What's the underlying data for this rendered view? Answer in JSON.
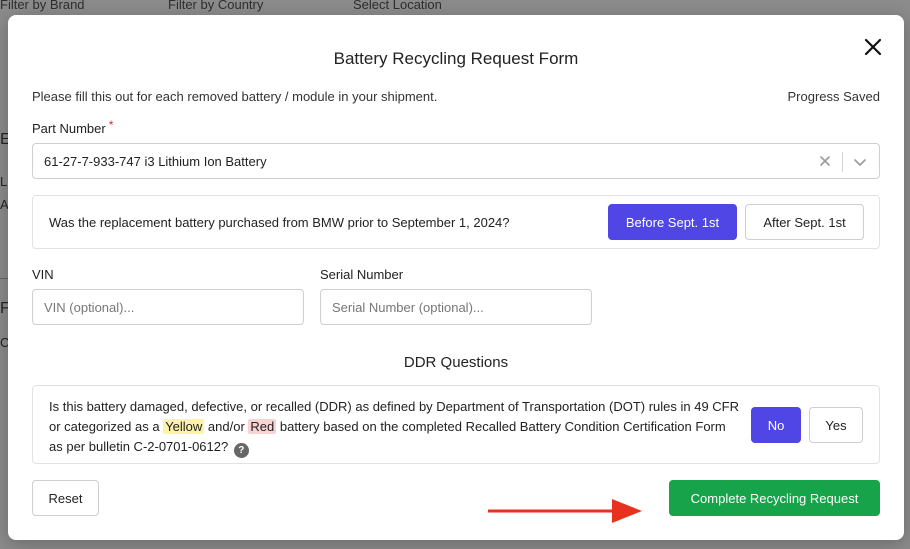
{
  "background": {
    "filters": [
      "Filter by Brand",
      "Filter by Country",
      "Select Location"
    ],
    "letters": [
      "E",
      "L",
      "A",
      "F",
      "C"
    ]
  },
  "modal": {
    "title": "Battery Recycling Request Form",
    "intro": "Please fill this out for each removed battery / module in your shipment.",
    "progress_status": "Progress Saved",
    "part_number": {
      "label": "Part Number",
      "required_mark": "*",
      "value": "61-27-7-933-747 i3 Lithium Ion Battery"
    },
    "purchase_question": {
      "text": "Was the replacement battery purchased from BMW prior to September 1, 2024?",
      "options": [
        "Before Sept. 1st",
        "After Sept. 1st"
      ],
      "selected": "Before Sept. 1st"
    },
    "vin": {
      "label": "VIN",
      "placeholder": "VIN (optional)..."
    },
    "serial": {
      "label": "Serial Number",
      "placeholder": "Serial Number (optional)..."
    },
    "ddr": {
      "section_title": "DDR Questions",
      "text_part1": "Is this battery damaged, defective, or recalled (DDR) as defined by Department of Transportation (DOT) rules in 49 CFR or categorized as a ",
      "yellow": "Yellow",
      "text_part2": " and/or ",
      "red": "Red",
      "text_part3": " battery based on the completed Recalled Battery Condition Certification Form as per bulletin C-2-0701-0612?",
      "help": "?",
      "options": [
        "No",
        "Yes"
      ],
      "selected": "No"
    },
    "reset_label": "Reset",
    "submit_label": "Complete Recycling Request"
  },
  "colors": {
    "primary": "#4f46e5",
    "success": "#16a34a",
    "required": "#d62d2d",
    "arrow": "#e8321f"
  },
  "icons": {
    "close": "close-icon",
    "clear": "clear-icon",
    "chevron": "chevron-down-icon",
    "help": "help-icon",
    "arrow": "arrow-right-icon"
  }
}
